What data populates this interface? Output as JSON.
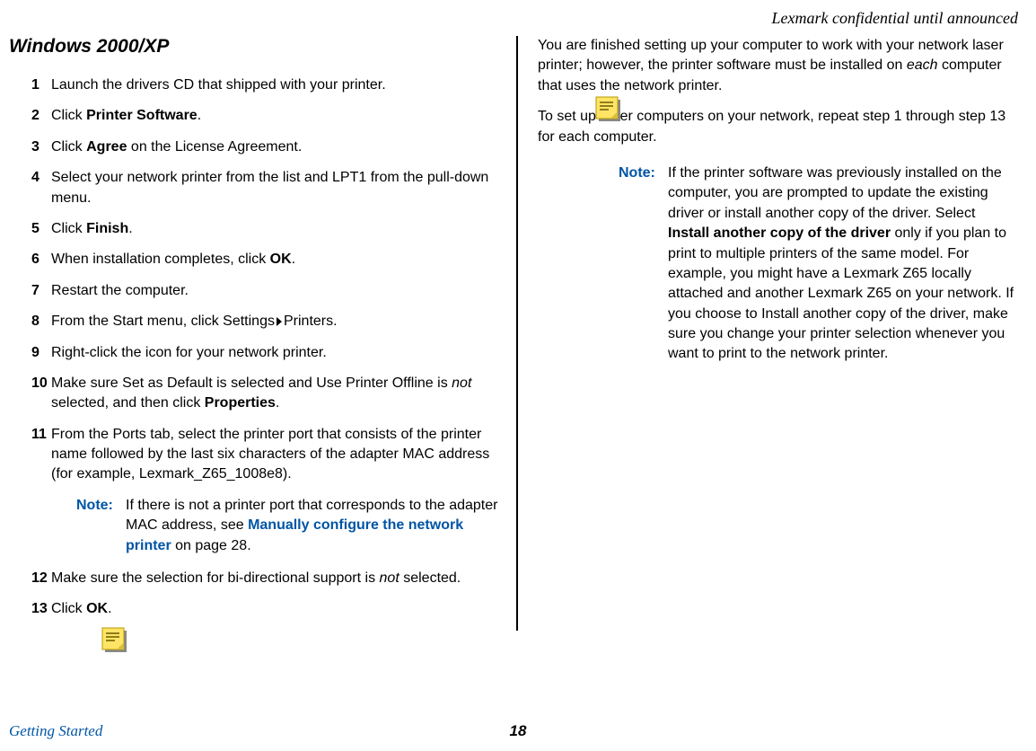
{
  "header": {
    "right": "Lexmark confidential until announced"
  },
  "left": {
    "heading": "Windows 2000/XP",
    "steps": {
      "n1": "1",
      "t1": "Launch the drivers CD that shipped with your printer.",
      "n2": "2",
      "t2a": "Click ",
      "t2b": "Printer Software",
      "t2c": ".",
      "n3": "3",
      "t3a": "Click ",
      "t3b": "Agree",
      "t3c": " on the License Agreement.",
      "n4": "4",
      "t4": "Select your network printer from the list and LPT1 from the pull-down menu.",
      "n5": "5",
      "t5a": "Click ",
      "t5b": "Finish",
      "t5c": ".",
      "n6": "6",
      "t6a": "When installation completes, click ",
      "t6b": "OK",
      "t6c": ".",
      "n7": "7",
      "t7": "Restart the computer.",
      "n8": "8",
      "t8a": "From the Start menu, click Settings",
      "t8b": "Printers.",
      "n9": "9",
      "t9": "Right-click the icon for your network printer.",
      "n10": "10",
      "t10a": "Make sure Set as Default is selected and Use Printer Offline is ",
      "t10b": "not",
      "t10c": " selected, and then click ",
      "t10d": "Properties",
      "t10e": ".",
      "n11": "11",
      "t11": "From the Ports tab, select the printer port that consists of the printer name followed by the last six characters of the adapter MAC address (for example, Lexmark_Z65_1008e8).",
      "note_label": "Note:",
      "note_a": "If there is not a printer port that corresponds to the adapter MAC address, see ",
      "note_link": "Manually configure the network printer",
      "note_b": " on page 28.",
      "n12": "12",
      "t12a": "Make sure the selection for bi-directional support is ",
      "t12b": "not",
      "t12c": " selected.",
      "n13": "13",
      "t13a": "Click ",
      "t13b": "OK",
      "t13c": "."
    }
  },
  "right": {
    "p1a": "You are finished setting up your computer to work with your network laser printer; however, the printer software must be installed on ",
    "p1b": "each",
    "p1c": " computer that uses the network printer.",
    "p2": "To set up other computers on your network, repeat step 1 through step 13 for each computer.",
    "note_label": "Note:",
    "note_a": "If the printer software was previously installed on the computer, you are prompted to update the existing driver or install another copy of the driver. Select ",
    "note_b": "Install another copy of the driver",
    "note_c": " only if you plan to print to multiple printers of the same model. For example, you might have a Lexmark Z65 locally attached and another Lexmark Z65 on your network. If you choose to Install another copy of the driver, make sure you change your printer selection whenever you want to print to the network printer."
  },
  "footer": {
    "left": "Getting Started",
    "page": "18"
  }
}
